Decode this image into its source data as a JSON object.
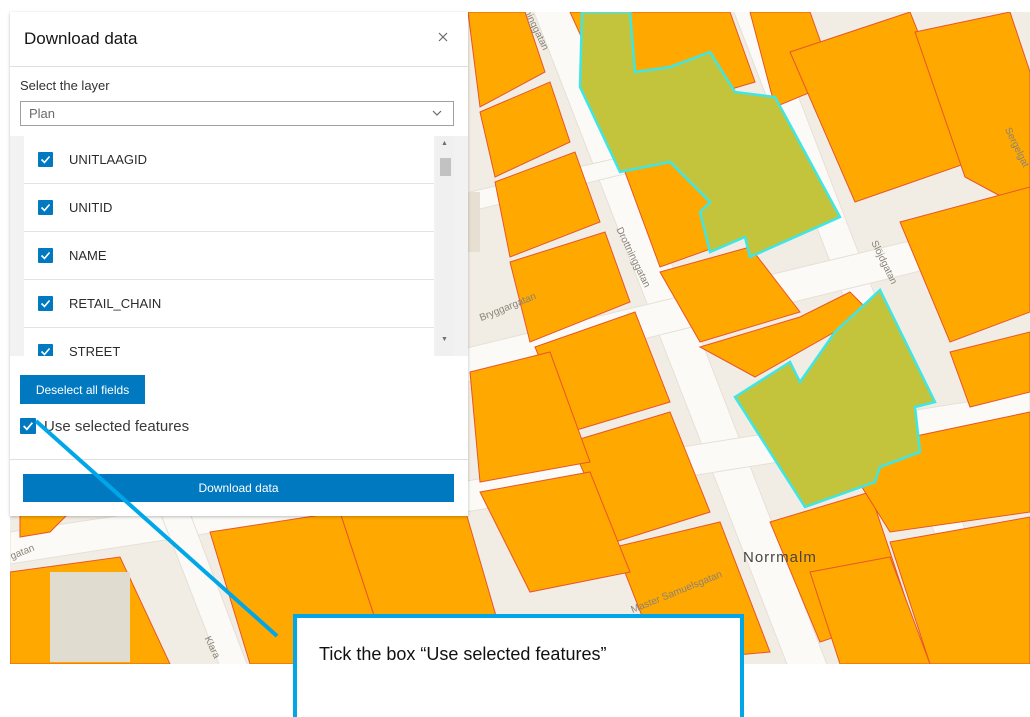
{
  "panel": {
    "title": "Download data",
    "close_icon": "close-icon",
    "layer_label": "Select the layer",
    "layer_value": "Plan",
    "fields": [
      {
        "name": "UNITLAAGID",
        "checked": true
      },
      {
        "name": "UNITID",
        "checked": true
      },
      {
        "name": "NAME",
        "checked": true
      },
      {
        "name": "RETAIL_CHAIN",
        "checked": true
      },
      {
        "name": "STREET",
        "checked": true
      }
    ],
    "deselect_label": "Deselect all fields",
    "use_selected_label": "Use selected features",
    "use_selected_checked": true,
    "download_label": "Download data"
  },
  "map": {
    "street_labels": {
      "drottninggatan_top": "ttninggatan",
      "drottninggatan": "Drottninggatan",
      "bryggargatan": "Bryggargatan",
      "slojdgatan": "Slöjdgatan",
      "sergelgatan": "Sergelgat",
      "gatan_left": "gatan",
      "master_samuelsgatan": "Master Samuelsgatan",
      "klara": "Klara"
    },
    "place_label": "Norrmalm",
    "colors": {
      "building": "#ffa800",
      "building_outline": "#e8552a",
      "selected_fill": "#c3c33c",
      "selected_outline": "#3fe6e6",
      "street": "#fbfaf7",
      "block_bg": "#f1ece3"
    }
  },
  "callout": {
    "text": "Tick the box “Use selected features”",
    "border_color": "#00a6e8"
  }
}
